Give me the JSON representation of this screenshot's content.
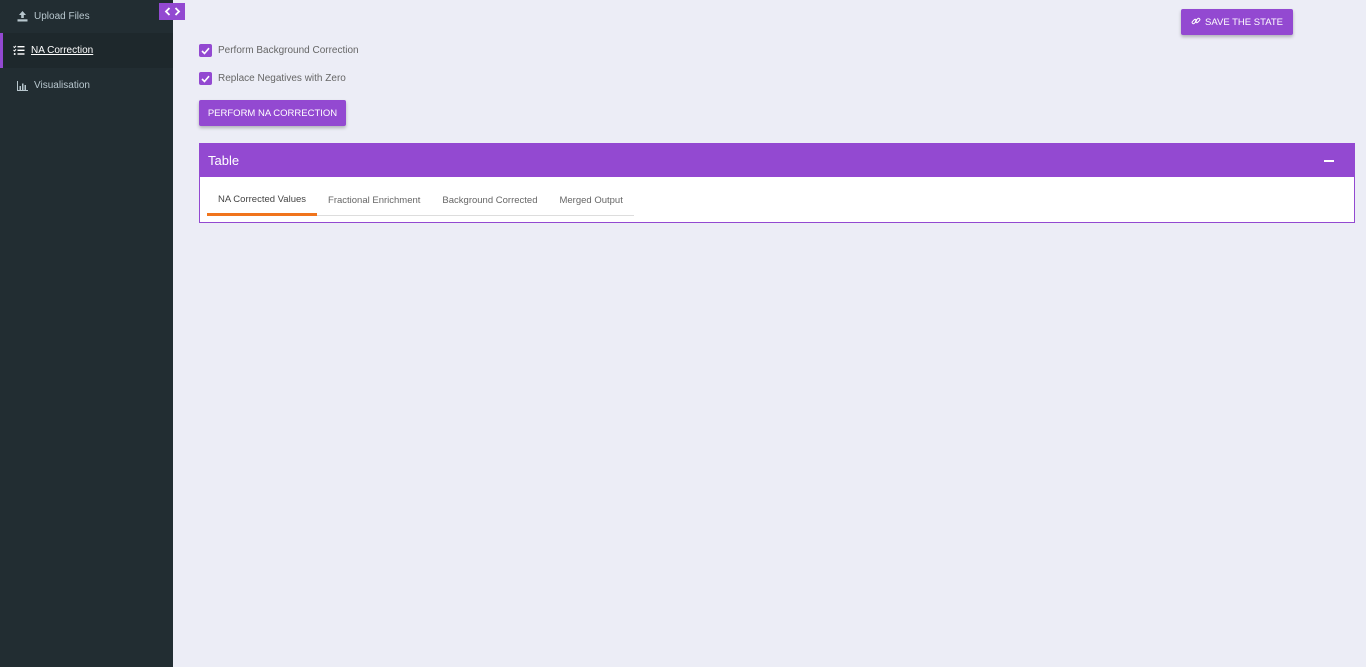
{
  "sidebar": {
    "items": [
      {
        "label": "Upload Files",
        "icon": "upload-icon"
      },
      {
        "label": "NA Correction",
        "icon": "list-check-icon",
        "active": true
      },
      {
        "label": "Visualisation",
        "icon": "bar-chart-icon"
      }
    ]
  },
  "header": {
    "save_label": "SAVE THE STATE"
  },
  "options": {
    "background_correction_label": "Perform Background Correction",
    "replace_negatives_label": "Replace Negatives with Zero",
    "perform_label": "PERFORM NA CORRECTION"
  },
  "table_box": {
    "title": "Table",
    "tabs": [
      "NA Corrected Values",
      "Fractional Enrichment",
      "Background Corrected",
      "Merged Output"
    ]
  },
  "colors": {
    "accent": "#9349d1",
    "tab_active": "#f0741c",
    "sidebar_bg": "#222d32"
  }
}
